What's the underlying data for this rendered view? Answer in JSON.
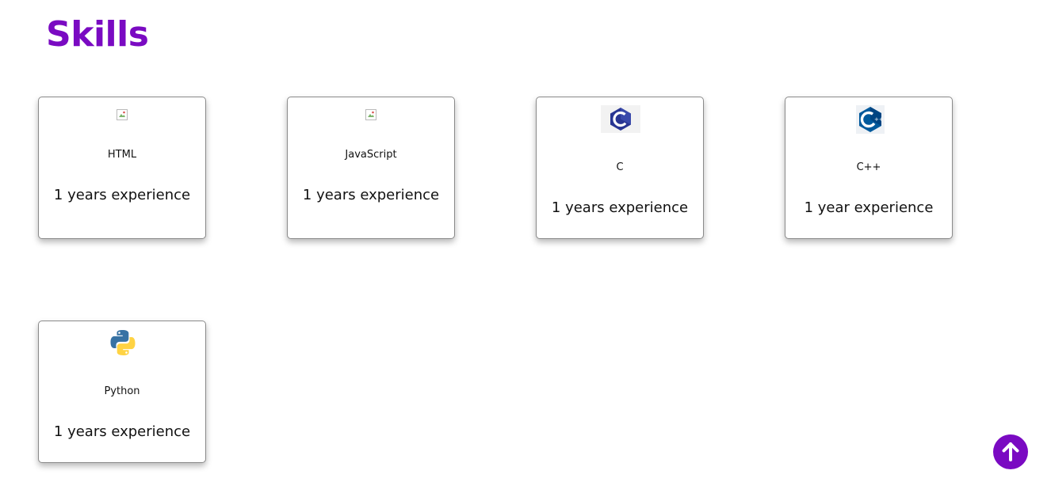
{
  "header": {
    "title": "Skills"
  },
  "colors": {
    "accent": "#7a0ac2",
    "text": "#111111",
    "card_border": "#8a8a8a"
  },
  "skills": [
    {
      "name": "HTML",
      "experience": "1 years experience",
      "icon": "broken-image-icon"
    },
    {
      "name": "JavaScript",
      "experience": "1 years experience",
      "icon": "broken-image-icon"
    },
    {
      "name": "C",
      "experience": "1 years experience",
      "icon": "c-language-logo-icon"
    },
    {
      "name": "C++",
      "experience": "1 year experience",
      "icon": "cpp-language-logo-icon"
    },
    {
      "name": "Python",
      "experience": "1 years experience",
      "icon": "python-logo-icon"
    }
  ],
  "scroll_top": {
    "icon": "arrow-up-icon"
  }
}
